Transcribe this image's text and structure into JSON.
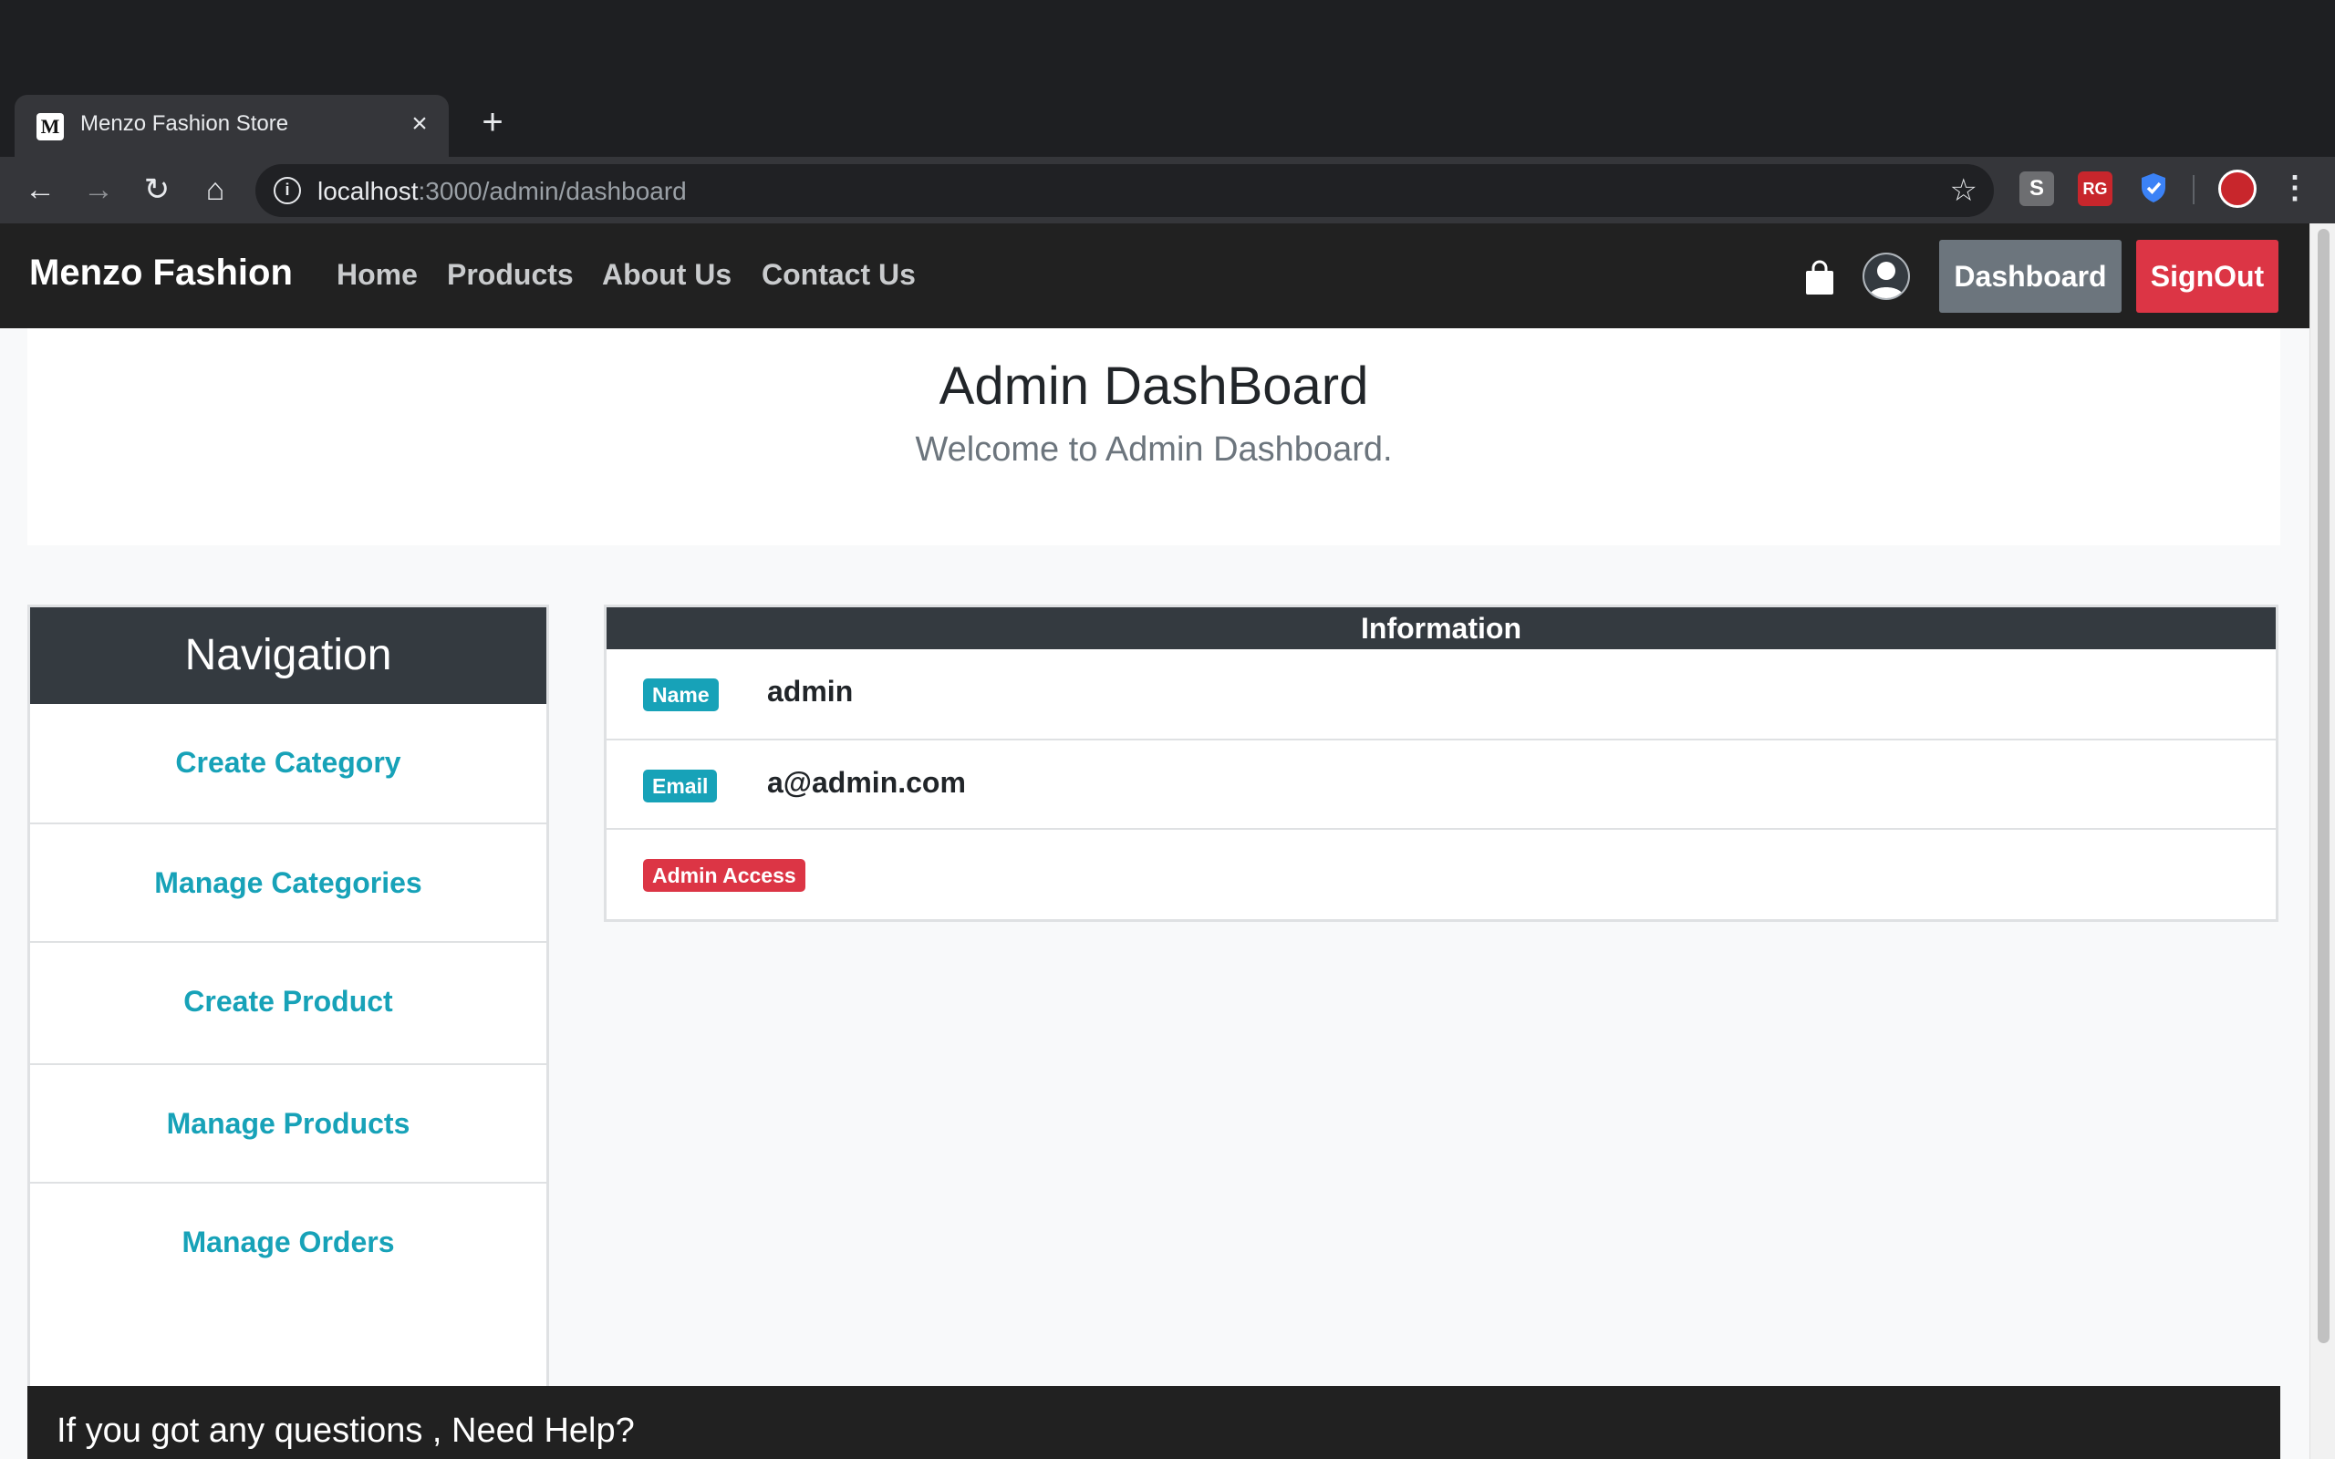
{
  "browser": {
    "tab_title": "Menzo Fashion Store",
    "tab_favicon": "M",
    "url_host": "localhost",
    "url_path": ":3000/admin/dashboard",
    "extensions": [
      "S",
      "RG"
    ]
  },
  "navbar": {
    "brand": "Menzo Fashion",
    "links": [
      "Home",
      "Products",
      "About Us",
      "Contact Us"
    ],
    "dashboard_label": "Dashboard",
    "signout_label": "SignOut"
  },
  "jumbotron": {
    "title": "Admin DashBoard",
    "subtitle": "Welcome to Admin Dashboard."
  },
  "navigation": {
    "title": "Navigation",
    "items": [
      "Create Category",
      "Manage Categories",
      "Create Product",
      "Manage Products",
      "Manage Orders"
    ]
  },
  "information": {
    "title": "Information",
    "name_badge": "Name",
    "name_value": "admin",
    "email_badge": "Email",
    "email_value": "a@admin.com",
    "access_badge": "Admin Access"
  },
  "footer": {
    "text": "If you got any questions , Need Help?"
  },
  "colors": {
    "navbar_bg": "#212121",
    "accent_info": "#17a2b8",
    "danger": "#dc3545",
    "secondary": "#6c757d"
  }
}
